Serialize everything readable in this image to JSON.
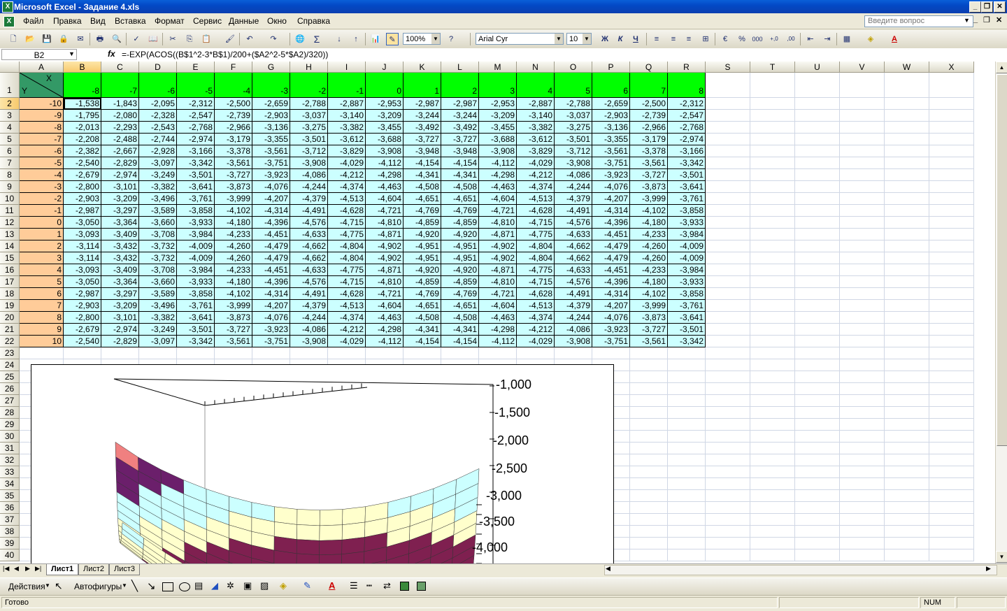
{
  "window": {
    "title": "Microsoft Excel - Задание 4.xls"
  },
  "menu": [
    "Файл",
    "Правка",
    "Вид",
    "Вставка",
    "Формат",
    "Сервис",
    "Данные",
    "Окно",
    "Справка"
  ],
  "ask_placeholder": "Введите вопрос",
  "toolbar": {
    "zoom": "100%",
    "font": "Arial Cyr",
    "size": "10",
    "bold": "Ж",
    "italic": "К",
    "underline": "Ч",
    "sigma": "Σ",
    "percent": "%",
    "thousands": "000",
    "inc_dec": "+,0",
    "dec_dec": ",00"
  },
  "formula_bar": {
    "name_box": "B2",
    "fx": "fx",
    "formula": "=-EXP(ACOS((B$1^2-3*B$1)/200+($A2^2-5*$A2)/320))"
  },
  "columns": [
    "A",
    "B",
    "C",
    "D",
    "E",
    "F",
    "G",
    "H",
    "I",
    "J",
    "K",
    "L",
    "M",
    "N",
    "O",
    "P",
    "Q",
    "R",
    "S",
    "T",
    "U",
    "V",
    "W",
    "X"
  ],
  "corner": {
    "x": "X",
    "y": "Y"
  },
  "x_values": [
    "-8",
    "-7",
    "-6",
    "-5",
    "-4",
    "-3",
    "-2",
    "-1",
    "0",
    "1",
    "2",
    "3",
    "4",
    "5",
    "6",
    "7",
    "8"
  ],
  "y_values": [
    "-10",
    "-9",
    "-8",
    "-7",
    "-6",
    "-5",
    "-4",
    "-3",
    "-2",
    "-1",
    "0",
    "1",
    "2",
    "3",
    "4",
    "5",
    "6",
    "7",
    "8",
    "9",
    "10"
  ],
  "rows": [
    [
      "-1,538",
      "-1,843",
      "-2,095",
      "-2,312",
      "-2,500",
      "-2,659",
      "-2,788",
      "-2,887",
      "-2,953",
      "-2,987",
      "-2,987",
      "-2,953",
      "-2,887",
      "-2,788",
      "-2,659",
      "-2,500",
      "-2,312"
    ],
    [
      "-1,795",
      "-2,080",
      "-2,328",
      "-2,547",
      "-2,739",
      "-2,903",
      "-3,037",
      "-3,140",
      "-3,209",
      "-3,244",
      "-3,244",
      "-3,209",
      "-3,140",
      "-3,037",
      "-2,903",
      "-2,739",
      "-2,547"
    ],
    [
      "-2,013",
      "-2,293",
      "-2,543",
      "-2,768",
      "-2,966",
      "-3,136",
      "-3,275",
      "-3,382",
      "-3,455",
      "-3,492",
      "-3,492",
      "-3,455",
      "-3,382",
      "-3,275",
      "-3,136",
      "-2,966",
      "-2,768"
    ],
    [
      "-2,208",
      "-2,488",
      "-2,744",
      "-2,974",
      "-3,179",
      "-3,355",
      "-3,501",
      "-3,612",
      "-3,688",
      "-3,727",
      "-3,727",
      "-3,688",
      "-3,612",
      "-3,501",
      "-3,355",
      "-3,179",
      "-2,974"
    ],
    [
      "-2,382",
      "-2,667",
      "-2,928",
      "-3,166",
      "-3,378",
      "-3,561",
      "-3,712",
      "-3,829",
      "-3,908",
      "-3,948",
      "-3,948",
      "-3,908",
      "-3,829",
      "-3,712",
      "-3,561",
      "-3,378",
      "-3,166"
    ],
    [
      "-2,540",
      "-2,829",
      "-3,097",
      "-3,342",
      "-3,561",
      "-3,751",
      "-3,908",
      "-4,029",
      "-4,112",
      "-4,154",
      "-4,154",
      "-4,112",
      "-4,029",
      "-3,908",
      "-3,751",
      "-3,561",
      "-3,342"
    ],
    [
      "-2,679",
      "-2,974",
      "-3,249",
      "-3,501",
      "-3,727",
      "-3,923",
      "-4,086",
      "-4,212",
      "-4,298",
      "-4,341",
      "-4,341",
      "-4,298",
      "-4,212",
      "-4,086",
      "-3,923",
      "-3,727",
      "-3,501"
    ],
    [
      "-2,800",
      "-3,101",
      "-3,382",
      "-3,641",
      "-3,873",
      "-4,076",
      "-4,244",
      "-4,374",
      "-4,463",
      "-4,508",
      "-4,508",
      "-4,463",
      "-4,374",
      "-4,244",
      "-4,076",
      "-3,873",
      "-3,641"
    ],
    [
      "-2,903",
      "-3,209",
      "-3,496",
      "-3,761",
      "-3,999",
      "-4,207",
      "-4,379",
      "-4,513",
      "-4,604",
      "-4,651",
      "-4,651",
      "-4,604",
      "-4,513",
      "-4,379",
      "-4,207",
      "-3,999",
      "-3,761"
    ],
    [
      "-2,987",
      "-3,297",
      "-3,589",
      "-3,858",
      "-4,102",
      "-4,314",
      "-4,491",
      "-4,628",
      "-4,721",
      "-4,769",
      "-4,769",
      "-4,721",
      "-4,628",
      "-4,491",
      "-4,314",
      "-4,102",
      "-3,858"
    ],
    [
      "-3,050",
      "-3,364",
      "-3,660",
      "-3,933",
      "-4,180",
      "-4,396",
      "-4,576",
      "-4,715",
      "-4,810",
      "-4,859",
      "-4,859",
      "-4,810",
      "-4,715",
      "-4,576",
      "-4,396",
      "-4,180",
      "-3,933"
    ],
    [
      "-3,093",
      "-3,409",
      "-3,708",
      "-3,984",
      "-4,233",
      "-4,451",
      "-4,633",
      "-4,775",
      "-4,871",
      "-4,920",
      "-4,920",
      "-4,871",
      "-4,775",
      "-4,633",
      "-4,451",
      "-4,233",
      "-3,984"
    ],
    [
      "-3,114",
      "-3,432",
      "-3,732",
      "-4,009",
      "-4,260",
      "-4,479",
      "-4,662",
      "-4,804",
      "-4,902",
      "-4,951",
      "-4,951",
      "-4,902",
      "-4,804",
      "-4,662",
      "-4,479",
      "-4,260",
      "-4,009"
    ],
    [
      "-3,114",
      "-3,432",
      "-3,732",
      "-4,009",
      "-4,260",
      "-4,479",
      "-4,662",
      "-4,804",
      "-4,902",
      "-4,951",
      "-4,951",
      "-4,902",
      "-4,804",
      "-4,662",
      "-4,479",
      "-4,260",
      "-4,009"
    ],
    [
      "-3,093",
      "-3,409",
      "-3,708",
      "-3,984",
      "-4,233",
      "-4,451",
      "-4,633",
      "-4,775",
      "-4,871",
      "-4,920",
      "-4,920",
      "-4,871",
      "-4,775",
      "-4,633",
      "-4,451",
      "-4,233",
      "-3,984"
    ],
    [
      "-3,050",
      "-3,364",
      "-3,660",
      "-3,933",
      "-4,180",
      "-4,396",
      "-4,576",
      "-4,715",
      "-4,810",
      "-4,859",
      "-4,859",
      "-4,810",
      "-4,715",
      "-4,576",
      "-4,396",
      "-4,180",
      "-3,933"
    ],
    [
      "-2,987",
      "-3,297",
      "-3,589",
      "-3,858",
      "-4,102",
      "-4,314",
      "-4,491",
      "-4,628",
      "-4,721",
      "-4,769",
      "-4,769",
      "-4,721",
      "-4,628",
      "-4,491",
      "-4,314",
      "-4,102",
      "-3,858"
    ],
    [
      "-2,903",
      "-3,209",
      "-3,496",
      "-3,761",
      "-3,999",
      "-4,207",
      "-4,379",
      "-4,513",
      "-4,604",
      "-4,651",
      "-4,651",
      "-4,604",
      "-4,513",
      "-4,379",
      "-4,207",
      "-3,999",
      "-3,761"
    ],
    [
      "-2,800",
      "-3,101",
      "-3,382",
      "-3,641",
      "-3,873",
      "-4,076",
      "-4,244",
      "-4,374",
      "-4,463",
      "-4,508",
      "-4,508",
      "-4,463",
      "-4,374",
      "-4,244",
      "-4,076",
      "-3,873",
      "-3,641"
    ],
    [
      "-2,679",
      "-2,974",
      "-3,249",
      "-3,501",
      "-3,727",
      "-3,923",
      "-4,086",
      "-4,212",
      "-4,298",
      "-4,341",
      "-4,341",
      "-4,298",
      "-4,212",
      "-4,086",
      "-3,923",
      "-3,727",
      "-3,501"
    ],
    [
      "-2,540",
      "-2,829",
      "-3,097",
      "-3,342",
      "-3,561",
      "-3,751",
      "-3,908",
      "-4,029",
      "-4,112",
      "-4,154",
      "-4,154",
      "-4,112",
      "-4,029",
      "-3,908",
      "-3,751",
      "-3,561",
      "-3,342"
    ]
  ],
  "chart": {
    "z_ticks": [
      "-1,000",
      "-1,500",
      "-2,000",
      "-2,500",
      "-3,000",
      "-3,500",
      "-4,000"
    ]
  },
  "sheet_tabs": [
    "Лист1",
    "Лист2",
    "Лист3"
  ],
  "drawing_bar": {
    "actions": "Действия",
    "autoshapes": "Автофигуры"
  },
  "status": {
    "ready": "Готово",
    "num": "NUM"
  },
  "colors": {
    "x_header": "#00ff00",
    "y_header": "#ffcc99",
    "data": "#ccffff",
    "title_bar": "#0349c6"
  }
}
